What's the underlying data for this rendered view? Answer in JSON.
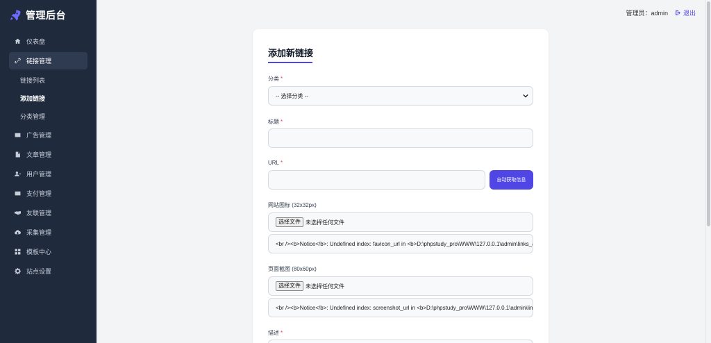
{
  "brand": {
    "title": "管理后台"
  },
  "sidebar": {
    "items": [
      {
        "label": "仪表盘",
        "icon": "home-icon"
      },
      {
        "label": "链接管理",
        "icon": "link-icon",
        "active": true,
        "children": [
          {
            "label": "链接列表"
          },
          {
            "label": "添加链接",
            "current": true
          },
          {
            "label": "分类管理"
          }
        ]
      },
      {
        "label": "广告管理",
        "icon": "ad-icon"
      },
      {
        "label": "文章管理",
        "icon": "file-icon"
      },
      {
        "label": "用户管理",
        "icon": "users-icon"
      },
      {
        "label": "支付管理",
        "icon": "wallet-icon"
      },
      {
        "label": "友联管理",
        "icon": "handshake-icon"
      },
      {
        "label": "采集管理",
        "icon": "cloud-download-icon"
      },
      {
        "label": "模板中心",
        "icon": "grid-icon"
      },
      {
        "label": "站点设置",
        "icon": "gear-icon"
      }
    ]
  },
  "topbar": {
    "admin_label": "管理员：admin",
    "logout_label": "退出"
  },
  "form": {
    "title": "添加新链接",
    "category_label": "分类",
    "category_selected": "-- 选择分类 --",
    "title_label": "标题",
    "title_value": "",
    "url_label": "URL",
    "url_value": "",
    "auto_fetch_label": "自动获取信息",
    "favicon_label": "网站图标 (32x32px)",
    "favicon_button": "选择文件",
    "favicon_file_text": "未选择任何文件",
    "favicon_value": "<br /><b>Notice</b>:  Undefined index: favicon_url in <b>D:\\phpstudy_pro\\WWW\\127.0.0.1\\admin\\links_add.php</b>",
    "screenshot_label": "页面截图 (80x60px)",
    "screenshot_button": "选择文件",
    "screenshot_file_text": "未选择任何文件",
    "screenshot_value": "<br /><b>Notice</b>:  Undefined index: screenshot_url in <b>D:\\phpstudy_pro\\WWW\\127.0.0.1\\admin\\links_add.php</b>",
    "description_label": "描述",
    "required_mark": "*"
  },
  "colors": {
    "sidebar_bg": "#1f2a3c",
    "accent": "#4f46e5",
    "required": "#ef4444"
  }
}
